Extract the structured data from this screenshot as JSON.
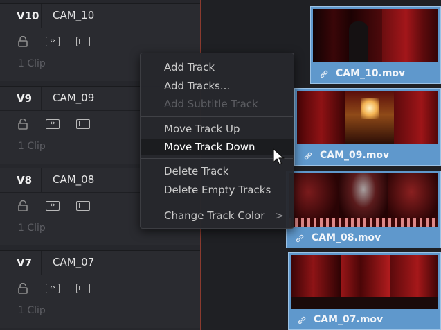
{
  "tracks": [
    {
      "id": "V10",
      "name": "CAM_10",
      "clips": "1 Clip"
    },
    {
      "id": "V9",
      "name": "CAM_09",
      "clips": "1 Clip"
    },
    {
      "id": "V8",
      "name": "CAM_08",
      "clips": "1 Clip"
    },
    {
      "id": "V7",
      "name": "CAM_07",
      "clips": "1 Clip"
    }
  ],
  "clips": [
    "CAM_10.mov",
    "CAM_09.mov",
    "CAM_08.mov",
    "CAM_07.mov"
  ],
  "menu": {
    "add_track": "Add Track",
    "add_tracks": "Add Tracks...",
    "add_subtitle_track": "Add Subtitle Track",
    "move_up": "Move Track Up",
    "move_down": "Move Track Down",
    "delete_track": "Delete Track",
    "delete_empty": "Delete Empty Tracks",
    "change_color": "Change Track Color",
    "submenu_arrow": ">"
  },
  "icons": {
    "lock": "lock-icon",
    "auto_select": "auto-select-icon",
    "disable_video": "disable-video-icon",
    "link": "link-icon",
    "cursor": "mouse-cursor-icon"
  },
  "colors": {
    "clip_blue": "#5f98cc",
    "playhead": "#8a3a2e",
    "menu_hover": "#1b1c1f"
  }
}
